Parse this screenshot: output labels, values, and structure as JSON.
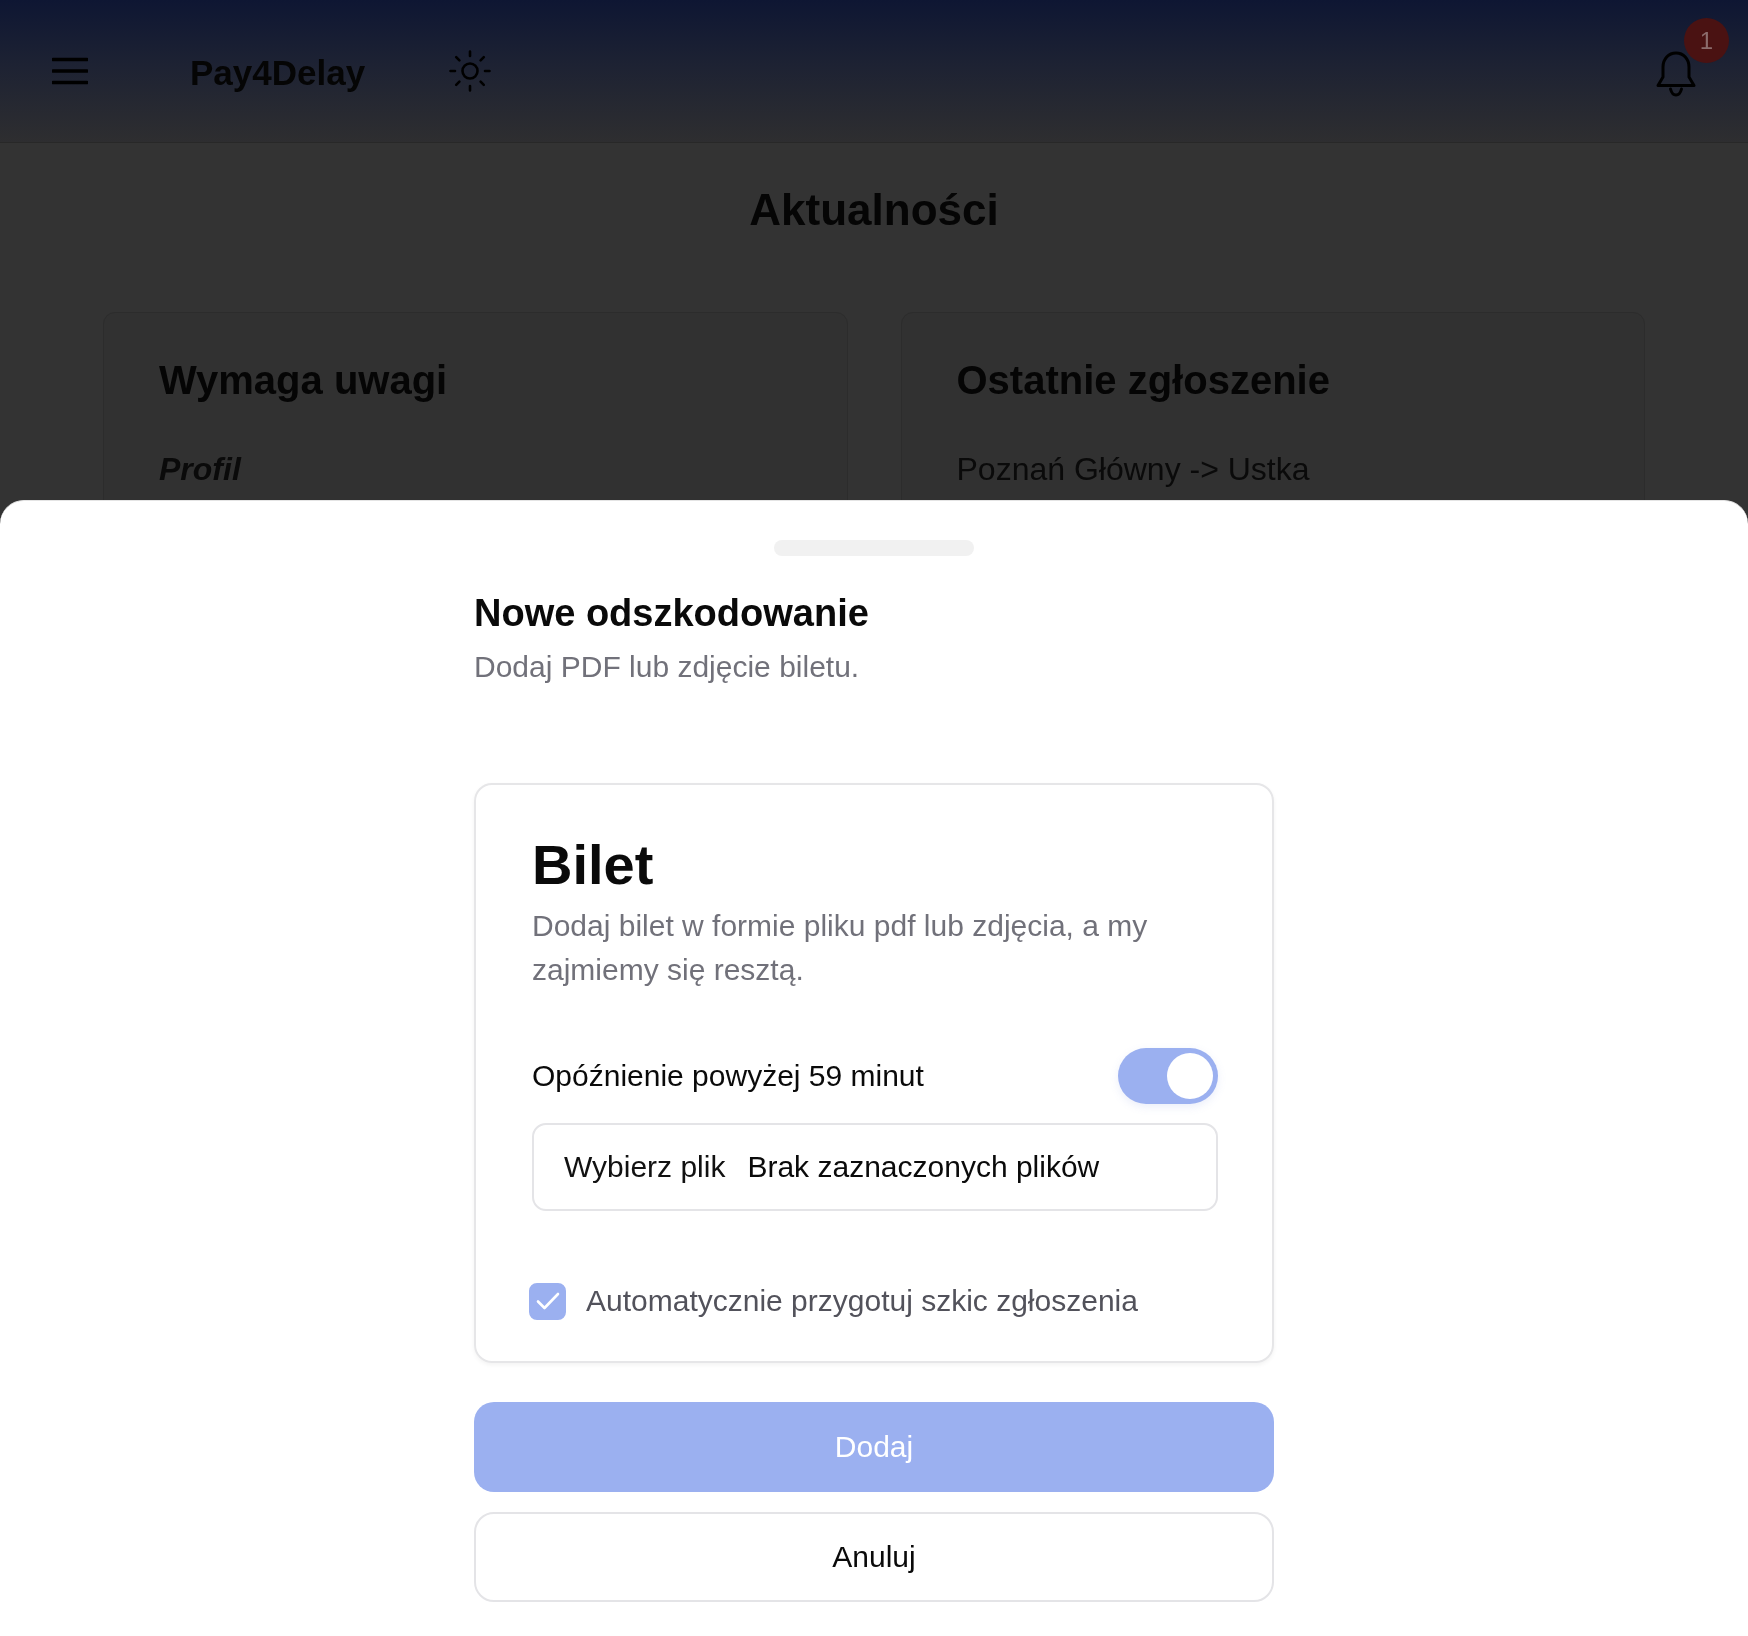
{
  "header": {
    "logo": "Pay4Delay",
    "notification_count": "1"
  },
  "page": {
    "title": "Aktualności",
    "cards": [
      {
        "title": "Wymaga uwagi",
        "item": "Profil",
        "kind": "emphasis"
      },
      {
        "title": "Ostatnie zgłoszenie",
        "item": "Poznań Główny -> Ustka",
        "kind": "text"
      }
    ]
  },
  "sheet": {
    "title": "Nowe odszkodowanie",
    "subtitle": "Dodaj PDF lub zdjęcie biletu.",
    "card": {
      "title": "Bilet",
      "description": "Dodaj bilet w formie pliku pdf lub zdjęcia, a my zajmiemy się resztą.",
      "toggle": {
        "label": "Opóźnienie powyżej 59 minut",
        "on": true
      },
      "file_input": {
        "button": "Wybierz plik",
        "status": "Brak zaznaczonych plików"
      },
      "checkbox": {
        "label": "Automatycznie przygotuj szkic zgłoszenia",
        "checked": true
      }
    },
    "buttons": [
      {
        "label": "Dodaj",
        "kind": "primary"
      },
      {
        "label": "Anuluj",
        "kind": "secondary"
      }
    ]
  }
}
